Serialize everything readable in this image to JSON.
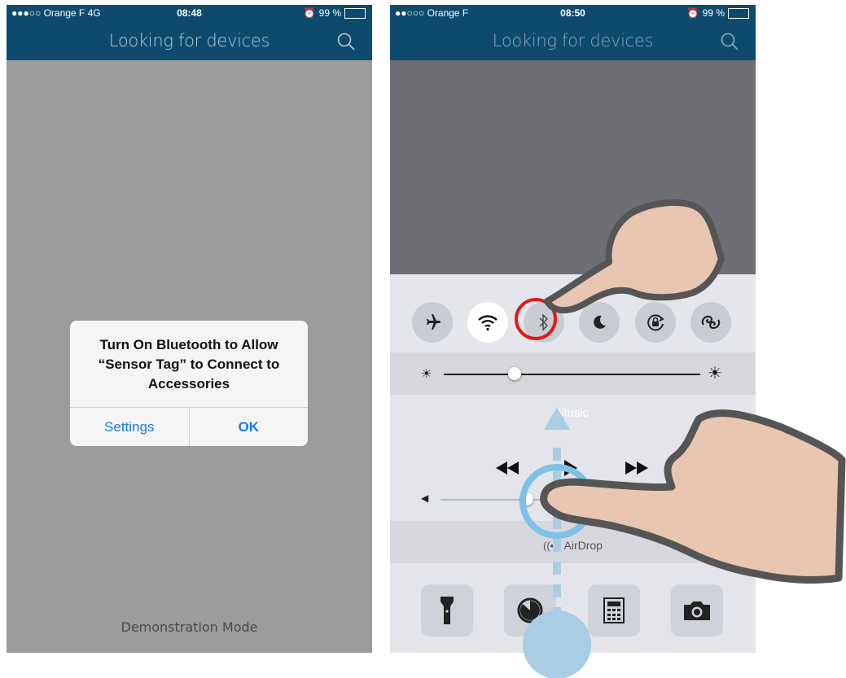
{
  "left_screen": {
    "status": {
      "carrier": "●●●○○ Orange F  4G",
      "time": "08:48",
      "battery": "99 %"
    },
    "nav": {
      "title": "Looking for devices"
    },
    "alert": {
      "line1": "Turn On Bluetooth to Allow",
      "line2": "“Sensor Tag” to Connect to",
      "line3": "Accessories",
      "settings_label": "Settings",
      "ok_label": "OK"
    },
    "footer": "Demonstration Mode"
  },
  "right_screen": {
    "status": {
      "carrier": "●●○○○ Orange F",
      "time": "08:50",
      "battery": "99 %"
    },
    "nav": {
      "title": "Looking for devices"
    },
    "control_center": {
      "toggles": [
        "airplane-icon",
        "wifi-icon",
        "bluetooth-icon",
        "moon-icon",
        "rotation-lock-icon",
        "airplay-icon"
      ],
      "wifi_on": true,
      "music_label": "Music",
      "airdrop_label": "AirDrop",
      "brightness_level": 0.27,
      "volume_level": 0.3,
      "shortcuts": [
        "flashlight-icon",
        "timer-icon",
        "calculator-icon",
        "camera-icon"
      ]
    }
  },
  "colors": {
    "nav_bg": "#0d4a6e",
    "nav_title": "#b9c9d6",
    "left_bg": "#9c9c9c",
    "alert_button": "#1a7be2",
    "highlight_circle": "#e01919",
    "gesture_arrow": "#a9cde3"
  }
}
